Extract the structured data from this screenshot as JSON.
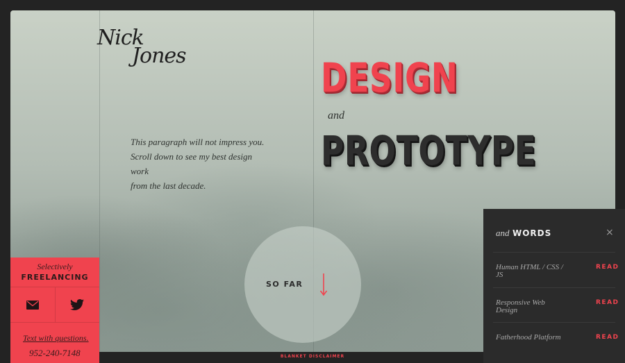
{
  "brand": {
    "line1": "Nick",
    "line2": "Jones"
  },
  "intro": {
    "lines": [
      "This paragraph will not impress you.",
      "Scroll down to see my best design work",
      "from the last decade."
    ]
  },
  "hero": {
    "word1": "DESIGN",
    "connector": "and",
    "word2": "PROTOTYPE"
  },
  "so_far": {
    "label": "SO FAR",
    "icon": "down-arrow-icon"
  },
  "sidebar": {
    "selectively": "Selectively",
    "freelancing": "FREELANCING",
    "icons": [
      "mail-icon",
      "twitter-icon"
    ],
    "text_prompt": "Text with questions.",
    "phone": "952-240-7148"
  },
  "words_panel": {
    "and": "and",
    "title": "WORDS",
    "close": "×",
    "items": [
      {
        "title": "Human HTML / CSS / JS",
        "action": "READ"
      },
      {
        "title": "Responsive Web Design",
        "action": "READ"
      },
      {
        "title": "Fatherhood Platform",
        "action": "READ"
      }
    ]
  },
  "footer": {
    "disclaimer": "BLANKET DISCLAIMER"
  },
  "colors": {
    "accent": "#f0434e",
    "dark": "#2d2d2d",
    "panel": "#2b2b2b",
    "frame_border": "#232323"
  }
}
